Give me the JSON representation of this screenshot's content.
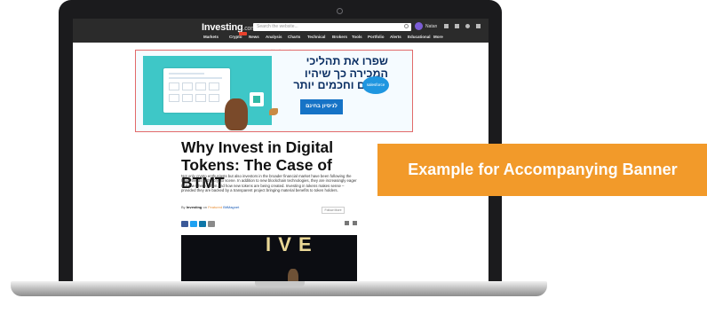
{
  "header": {
    "logo": "Investing",
    "logo_suffix": ".com",
    "search_placeholder": "Search the website...",
    "user_name": "Natan",
    "nav_items": [
      "Markets",
      "Crypto",
      "News",
      "Analysis",
      "Charts",
      "Technical",
      "Brokers",
      "Tools",
      "Portfolio",
      "Alerts",
      "Educational",
      "More"
    ]
  },
  "ad": {
    "label": "Advertisement",
    "headline": "שפרו את תהליכי המכירה כך שיהיו יעילים וחכמים יותר",
    "cta": "לניסיון בחינם",
    "brand": "salesforce"
  },
  "article": {
    "title": "Why Invest in Digital Tokens: The Case of BTMT",
    "body": "Not only crypto enthusiasts but also investors in the broader financial market have been following the latest trends in the crypto scene. In addition to new blockchain technologies, they are increasingly eager to know where, when and how new tokens are being created. Investing in tokens makes sense – provided they are backed by a transparent project bringing material benefits to token holders.",
    "byline_prefix": "By",
    "byline_org": "Investing",
    "byline_mid": "on",
    "byline_link": "BitMagnet",
    "byline_tag": "Featured",
    "follow": "Follow More"
  },
  "overlay": {
    "banner_text": "Example for Accompanying Banner"
  },
  "colors": {
    "accent": "#f29a2a",
    "header_bg": "#2b2b2b",
    "ad_border": "#e26a6a",
    "cta": "#1673c6"
  }
}
